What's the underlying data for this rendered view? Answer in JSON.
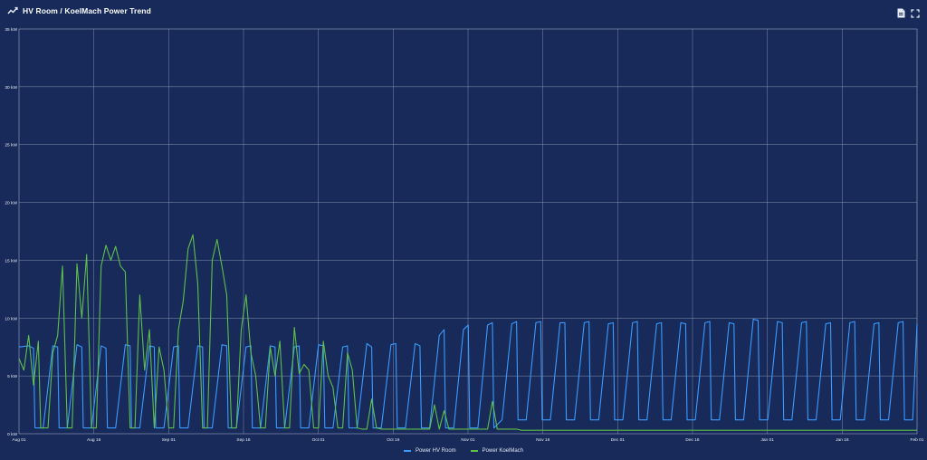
{
  "header": {
    "title": "HV Room / KoelMach Power Trend",
    "icons": {
      "trend": "trend-line-icon",
      "export": "document-export-icon",
      "expand": "expand-icon"
    }
  },
  "colors": {
    "background": "#172a5a",
    "grid": "#8d99b8",
    "text": "#e6ebf5",
    "hv": "#3a9bff",
    "koel": "#5fbf4a"
  },
  "chart_data": {
    "type": "line",
    "y_tick_labels": [
      "0 kW",
      "5 kW",
      "10 kW",
      "15 kW",
      "20 kW",
      "25 kW",
      "30 kW",
      "35 kW"
    ],
    "ylim": [
      0,
      35
    ],
    "x_tick_labels": [
      "Aug 01",
      "Aug 16",
      "Sep 01",
      "Sep 16",
      "Oct 01",
      "Oct 16",
      "Nov 01",
      "Nov 16",
      "Dec 01",
      "Dec 16",
      "Jan 01",
      "Jan 16",
      "Feb 01"
    ],
    "x_unit_per_tick": "15.5 days",
    "grid": true,
    "legend_position": "bottom-center",
    "series": [
      {
        "name": "Power HV Room",
        "color": "#3a9bff",
        "x_days": [
          0,
          2,
          3,
          3.3,
          5,
          7,
          8,
          8.3,
          10,
          12,
          13,
          13.3,
          15,
          17,
          18,
          18.3,
          20,
          22,
          23,
          23.3,
          25,
          27,
          28,
          28.3,
          30,
          32,
          33,
          33.3,
          35,
          37,
          38,
          38.3,
          40,
          42,
          43,
          43.3,
          45,
          47,
          48,
          48.3,
          50,
          52,
          53,
          53.3,
          55,
          57,
          58,
          58.3,
          60,
          62,
          63,
          63.3,
          65,
          67,
          68,
          68.3,
          70,
          72,
          73,
          73.3,
          75,
          77,
          78,
          78.3,
          80,
          82,
          83,
          83.3,
          85,
          87,
          88,
          88.3,
          90,
          92,
          93,
          93.3,
          95,
          97,
          98,
          98.3,
          100,
          102,
          103,
          103.3,
          105,
          107,
          108,
          108.3,
          110,
          112,
          113,
          113.3,
          115,
          117,
          118,
          118.3,
          120,
          122,
          123,
          123.3,
          125,
          127,
          128,
          128.3,
          130,
          132,
          133,
          133.3,
          135,
          137,
          138,
          138.3,
          140,
          142,
          143,
          143.3,
          145,
          147,
          148,
          148.3,
          150,
          152,
          153,
          153.3,
          155,
          157,
          158,
          158.3,
          160,
          162,
          163,
          163.3,
          165,
          167,
          168,
          168.3,
          170,
          172,
          173,
          173.3,
          175,
          177,
          178,
          178.3,
          180,
          182,
          183,
          183.3,
          185,
          185.9
        ],
        "y_kw": [
          7.5,
          7.6,
          7.4,
          0.5,
          0.5,
          7.6,
          7.5,
          0.5,
          0.5,
          7.7,
          7.5,
          0.5,
          0.5,
          7.6,
          7.4,
          0.5,
          0.5,
          7.7,
          7.6,
          0.5,
          0.5,
          7.6,
          7.5,
          0.5,
          0.5,
          7.5,
          7.6,
          0.5,
          0.5,
          7.6,
          7.5,
          0.5,
          0.5,
          7.7,
          7.6,
          0.5,
          0.5,
          7.5,
          7.6,
          0.5,
          0.5,
          7.6,
          7.5,
          0.5,
          0.5,
          7.5,
          7.6,
          0.5,
          0.5,
          7.7,
          7.6,
          0.5,
          0.5,
          7.5,
          7.6,
          0.5,
          0.5,
          7.8,
          7.5,
          0.5,
          0.5,
          7.7,
          7.8,
          0.5,
          0.5,
          7.8,
          7.6,
          0.5,
          0.5,
          8.5,
          9.0,
          0.5,
          0.5,
          9.0,
          9.4,
          0.5,
          0.5,
          9.4,
          9.6,
          0.5,
          1.2,
          9.5,
          9.7,
          1.2,
          1.2,
          9.6,
          9.7,
          1.2,
          1.2,
          9.6,
          9.6,
          1.2,
          1.2,
          9.6,
          9.7,
          1.2,
          1.2,
          9.5,
          9.6,
          1.2,
          1.2,
          9.6,
          9.7,
          1.2,
          1.2,
          9.5,
          9.6,
          1.2,
          1.2,
          9.6,
          9.5,
          1.2,
          1.2,
          9.6,
          9.7,
          1.2,
          1.2,
          9.6,
          9.5,
          1.2,
          1.2,
          9.9,
          9.8,
          1.2,
          1.2,
          9.7,
          9.6,
          1.2,
          1.2,
          9.6,
          9.7,
          1.2,
          1.2,
          9.5,
          9.6,
          1.2,
          1.2,
          9.6,
          9.7,
          1.2,
          1.2,
          9.5,
          9.6,
          1.2,
          1.2,
          9.6,
          9.7,
          1.2,
          1.2,
          9.5,
          9.6,
          1.2,
          1.2,
          9.6,
          9.7,
          1.2,
          1.2,
          9.5,
          9.8,
          0.2
        ]
      },
      {
        "name": "Power KoelMach",
        "color": "#5fbf4a",
        "x_days": [
          0,
          1,
          2,
          3,
          4,
          4.5,
          5,
          6,
          7,
          8,
          9,
          10,
          11,
          12,
          13,
          14,
          15,
          16,
          17,
          18,
          19,
          20,
          21,
          22,
          23,
          24,
          25,
          26,
          27,
          28,
          29,
          30,
          31,
          32,
          33,
          34,
          35,
          36,
          37,
          38,
          39,
          40,
          41,
          42,
          43,
          44,
          45,
          46,
          47,
          48,
          49,
          50,
          51,
          52,
          53,
          54,
          55,
          56,
          57,
          58,
          59,
          60,
          61,
          62,
          63,
          64,
          65,
          66,
          67,
          68,
          69,
          70,
          71,
          72,
          73,
          74,
          75,
          76,
          77,
          78,
          79,
          80,
          81,
          82,
          83,
          84,
          85,
          86,
          87,
          88,
          89,
          90,
          91,
          92,
          93,
          94,
          95,
          96,
          97,
          98,
          99,
          100,
          101,
          102,
          103,
          104,
          185.9
        ],
        "y_kw": [
          6.5,
          5.5,
          8.5,
          4.2,
          8.0,
          0.5,
          0.5,
          0.5,
          7.0,
          8.5,
          14.5,
          0.5,
          0.5,
          14.7,
          10.0,
          15.5,
          0.5,
          0.5,
          14.5,
          16.3,
          15.0,
          16.2,
          14.5,
          14.0,
          0.5,
          0.5,
          12.0,
          5.5,
          9.0,
          0.5,
          7.5,
          5.5,
          0.5,
          0.5,
          9.0,
          11.5,
          16.0,
          17.2,
          13.0,
          0.5,
          0.5,
          15.0,
          16.8,
          14.5,
          12.0,
          0.5,
          0.5,
          9.0,
          12.0,
          7.0,
          5.0,
          0.5,
          0.5,
          7.5,
          5.0,
          8.0,
          0.5,
          0.5,
          9.2,
          5.2,
          6.0,
          5.5,
          0.5,
          0.5,
          8.0,
          5.0,
          4.0,
          0.5,
          0.5,
          7.0,
          5.5,
          0.5,
          0.4,
          0.4,
          3.0,
          0.5,
          0.4,
          0.4,
          0.4,
          0.4,
          0.4,
          0.4,
          0.4,
          0.4,
          0.4,
          0.4,
          0.4,
          2.5,
          0.4,
          2.0,
          0.4,
          0.4,
          0.4,
          0.4,
          0.4,
          0.4,
          0.4,
          0.4,
          0.4,
          2.8,
          0.4,
          0.4,
          0.4,
          0.4,
          0.4,
          0.3,
          0.3
        ]
      }
    ]
  }
}
